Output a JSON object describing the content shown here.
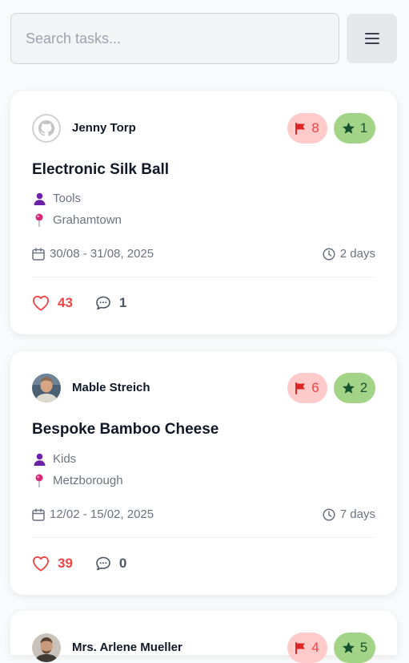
{
  "search": {
    "placeholder": "Search tasks..."
  },
  "menu": {
    "icon": "hamburger-icon"
  },
  "tasks": [
    {
      "author": "Jenny Torp",
      "avatar": "github-avatar-icon",
      "flags": "8",
      "stars": "1",
      "title": "Electronic Silk Ball",
      "category": "Tools",
      "location": "Grahamtown",
      "dates": "30/08 - 31/08, 2025",
      "duration": "2 days",
      "likes": "43",
      "comments": "1"
    },
    {
      "author": "Mable Streich",
      "avatar": "photo-avatar",
      "flags": "6",
      "stars": "2",
      "title": "Bespoke Bamboo Cheese",
      "category": "Kids",
      "location": "Metzborough",
      "dates": "12/02 - 15/02, 2025",
      "duration": "7 days",
      "likes": "39",
      "comments": "0"
    },
    {
      "author": "Mrs. Arlene Mueller",
      "avatar": "photo-avatar",
      "flags": "4",
      "stars": "5"
    }
  ],
  "colors": {
    "flag_badge_bg": "#fecaca",
    "flag_color": "#ef4444",
    "star_badge_bg": "#a3d387",
    "star_color": "#14532d",
    "like_color": "#ef4444",
    "person_icon_color": "#6b21a8",
    "pin_icon_color": "#db2777"
  }
}
